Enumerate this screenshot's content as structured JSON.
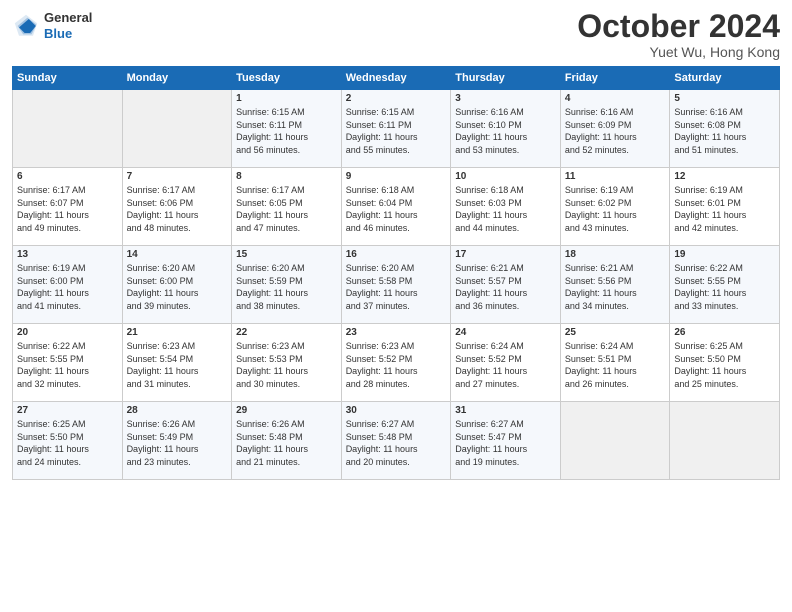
{
  "header": {
    "logo_line1": "General",
    "logo_line2": "Blue",
    "month": "October 2024",
    "location": "Yuet Wu, Hong Kong"
  },
  "weekdays": [
    "Sunday",
    "Monday",
    "Tuesday",
    "Wednesday",
    "Thursday",
    "Friday",
    "Saturday"
  ],
  "weeks": [
    [
      {
        "day": "",
        "empty": true
      },
      {
        "day": "",
        "empty": true
      },
      {
        "day": "1",
        "sunrise": "6:15 AM",
        "sunset": "6:11 PM",
        "daylight": "11 hours and 56 minutes."
      },
      {
        "day": "2",
        "sunrise": "6:15 AM",
        "sunset": "6:11 PM",
        "daylight": "11 hours and 55 minutes."
      },
      {
        "day": "3",
        "sunrise": "6:16 AM",
        "sunset": "6:10 PM",
        "daylight": "11 hours and 53 minutes."
      },
      {
        "day": "4",
        "sunrise": "6:16 AM",
        "sunset": "6:09 PM",
        "daylight": "11 hours and 52 minutes."
      },
      {
        "day": "5",
        "sunrise": "6:16 AM",
        "sunset": "6:08 PM",
        "daylight": "11 hours and 51 minutes."
      }
    ],
    [
      {
        "day": "6",
        "sunrise": "6:17 AM",
        "sunset": "6:07 PM",
        "daylight": "11 hours and 49 minutes."
      },
      {
        "day": "7",
        "sunrise": "6:17 AM",
        "sunset": "6:06 PM",
        "daylight": "11 hours and 48 minutes."
      },
      {
        "day": "8",
        "sunrise": "6:17 AM",
        "sunset": "6:05 PM",
        "daylight": "11 hours and 47 minutes."
      },
      {
        "day": "9",
        "sunrise": "6:18 AM",
        "sunset": "6:04 PM",
        "daylight": "11 hours and 46 minutes."
      },
      {
        "day": "10",
        "sunrise": "6:18 AM",
        "sunset": "6:03 PM",
        "daylight": "11 hours and 44 minutes."
      },
      {
        "day": "11",
        "sunrise": "6:19 AM",
        "sunset": "6:02 PM",
        "daylight": "11 hours and 43 minutes."
      },
      {
        "day": "12",
        "sunrise": "6:19 AM",
        "sunset": "6:01 PM",
        "daylight": "11 hours and 42 minutes."
      }
    ],
    [
      {
        "day": "13",
        "sunrise": "6:19 AM",
        "sunset": "6:00 PM",
        "daylight": "11 hours and 41 minutes."
      },
      {
        "day": "14",
        "sunrise": "6:20 AM",
        "sunset": "6:00 PM",
        "daylight": "11 hours and 39 minutes."
      },
      {
        "day": "15",
        "sunrise": "6:20 AM",
        "sunset": "5:59 PM",
        "daylight": "11 hours and 38 minutes."
      },
      {
        "day": "16",
        "sunrise": "6:20 AM",
        "sunset": "5:58 PM",
        "daylight": "11 hours and 37 minutes."
      },
      {
        "day": "17",
        "sunrise": "6:21 AM",
        "sunset": "5:57 PM",
        "daylight": "11 hours and 36 minutes."
      },
      {
        "day": "18",
        "sunrise": "6:21 AM",
        "sunset": "5:56 PM",
        "daylight": "11 hours and 34 minutes."
      },
      {
        "day": "19",
        "sunrise": "6:22 AM",
        "sunset": "5:55 PM",
        "daylight": "11 hours and 33 minutes."
      }
    ],
    [
      {
        "day": "20",
        "sunrise": "6:22 AM",
        "sunset": "5:55 PM",
        "daylight": "11 hours and 32 minutes."
      },
      {
        "day": "21",
        "sunrise": "6:23 AM",
        "sunset": "5:54 PM",
        "daylight": "11 hours and 31 minutes."
      },
      {
        "day": "22",
        "sunrise": "6:23 AM",
        "sunset": "5:53 PM",
        "daylight": "11 hours and 30 minutes."
      },
      {
        "day": "23",
        "sunrise": "6:23 AM",
        "sunset": "5:52 PM",
        "daylight": "11 hours and 28 minutes."
      },
      {
        "day": "24",
        "sunrise": "6:24 AM",
        "sunset": "5:52 PM",
        "daylight": "11 hours and 27 minutes."
      },
      {
        "day": "25",
        "sunrise": "6:24 AM",
        "sunset": "5:51 PM",
        "daylight": "11 hours and 26 minutes."
      },
      {
        "day": "26",
        "sunrise": "6:25 AM",
        "sunset": "5:50 PM",
        "daylight": "11 hours and 25 minutes."
      }
    ],
    [
      {
        "day": "27",
        "sunrise": "6:25 AM",
        "sunset": "5:50 PM",
        "daylight": "11 hours and 24 minutes."
      },
      {
        "day": "28",
        "sunrise": "6:26 AM",
        "sunset": "5:49 PM",
        "daylight": "11 hours and 23 minutes."
      },
      {
        "day": "29",
        "sunrise": "6:26 AM",
        "sunset": "5:48 PM",
        "daylight": "11 hours and 21 minutes."
      },
      {
        "day": "30",
        "sunrise": "6:27 AM",
        "sunset": "5:48 PM",
        "daylight": "11 hours and 20 minutes."
      },
      {
        "day": "31",
        "sunrise": "6:27 AM",
        "sunset": "5:47 PM",
        "daylight": "11 hours and 19 minutes."
      },
      {
        "day": "",
        "empty": true
      },
      {
        "day": "",
        "empty": true
      }
    ]
  ]
}
